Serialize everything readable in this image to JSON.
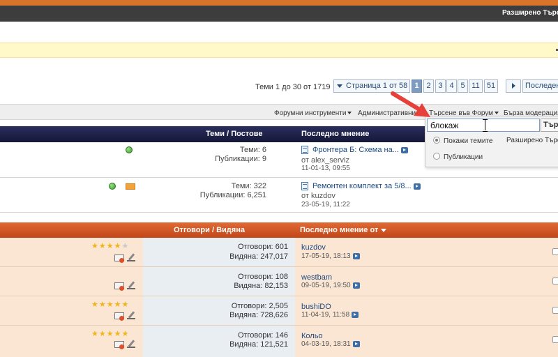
{
  "header": {
    "advanced_search": "Разширено Търсе"
  },
  "pagination": {
    "thread_count": "Теми 1 до 30 от 1719",
    "page_label": "Страница 1 от 58",
    "pages": [
      "1",
      "2",
      "3",
      "4",
      "5",
      "11",
      "51"
    ],
    "current_page": "1",
    "next_label": "Последен"
  },
  "toolbar": {
    "forum_tools": "Форумни инструменти",
    "admin": "Административни",
    "search_forum": "Търсене във Форум",
    "quick_mod": "Бърза модерация"
  },
  "search_popup": {
    "query": "блокаж",
    "button": "Търс",
    "option_threads": "Покажи темите",
    "option_posts": "Публикации",
    "advanced": "Разширено Търс"
  },
  "forum_table": {
    "col_threads_posts": "Теми / Постове",
    "col_last_post": "Последно мнение",
    "rows": [
      {
        "threads": "Теми: 6",
        "posts": "Публикации: 9",
        "last_title": "Фронтера Б: Схема на...",
        "by": "от alex_serviz",
        "date": "11-01-13, 09:55"
      },
      {
        "threads": "Теми: 322",
        "posts": "Публикации: 6,251",
        "last_title": "Ремонтен комплект за 5/8...",
        "by": "от kuzdov",
        "date": "23-05-19, 11:22"
      }
    ]
  },
  "thread_table": {
    "col_replies_views": "Отговори / Видяна",
    "col_last_post_by": "Последно мнение от",
    "rows": [
      {
        "rating": 4,
        "replies": "Отговори: 601",
        "views": "Видяна: 247,017",
        "user": "kuzdov",
        "date": "17-05-19, 18:13"
      },
      {
        "rating": 0,
        "replies": "Отговори: 108",
        "views": "Видяна: 82,153",
        "user": "westbam",
        "date": "09-05-19, 19:50"
      },
      {
        "rating": 5,
        "replies": "Отговори: 2,505",
        "views": "Видяна: 728,626",
        "user": "bushiDO",
        "date": "11-04-19, 11:58"
      },
      {
        "rating": 5,
        "replies": "Отговори: 146",
        "views": "Видяна: 121,521",
        "user": "Кольо",
        "date": "04-03-19, 18:31"
      }
    ]
  },
  "colors": {
    "accent_orange": "#c24619",
    "navy": "#151836",
    "arrow_red": "#e5413a"
  }
}
